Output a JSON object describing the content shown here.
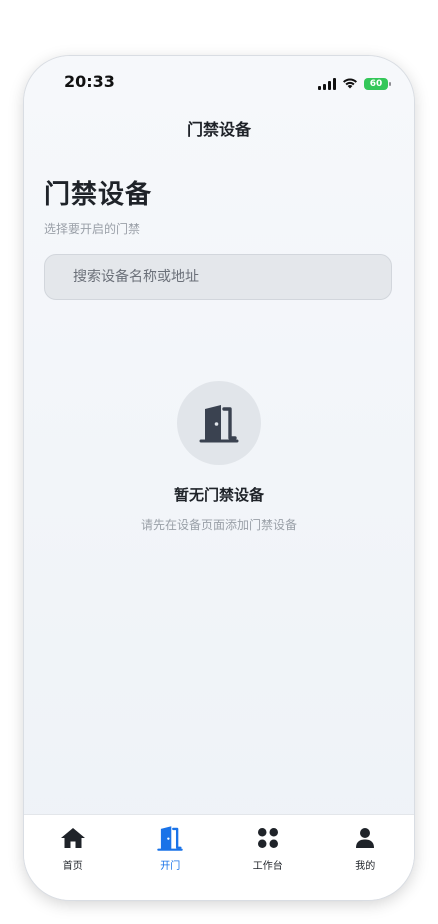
{
  "status_bar": {
    "time": "20:33",
    "battery": "60",
    "icons": [
      "signal-icon",
      "wifi-icon",
      "battery-icon"
    ]
  },
  "nav": {
    "title": "门禁设备"
  },
  "header": {
    "title": "门禁设备",
    "subtitle": "选择要开启的门禁"
  },
  "search": {
    "placeholder": "搜索设备名称或地址",
    "value": ""
  },
  "empty_state": {
    "icon": "door-icon",
    "title": "暂无门禁设备",
    "description": "请先在设备页面添加门禁设备"
  },
  "tab_bar": {
    "active_color": "#1a73e8",
    "items": [
      {
        "label": "首页",
        "icon": "home-icon",
        "active": false
      },
      {
        "label": "开门",
        "icon": "door-open-icon",
        "active": true
      },
      {
        "label": "工作台",
        "icon": "grid-icon",
        "active": false
      },
      {
        "label": "我的",
        "icon": "user-icon",
        "active": false
      }
    ]
  }
}
